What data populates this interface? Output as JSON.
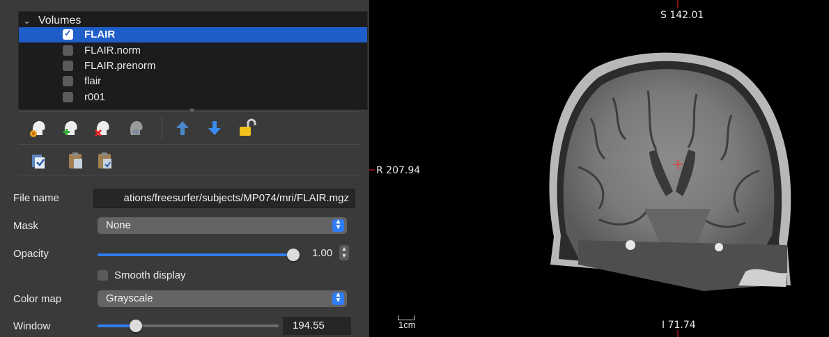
{
  "layer_tree": {
    "header": "Volumes",
    "items": [
      {
        "label": "FLAIR",
        "checked": true,
        "selected": true
      },
      {
        "label": "FLAIR.norm",
        "checked": false,
        "selected": false
      },
      {
        "label": "FLAIR.prenorm",
        "checked": false,
        "selected": false
      },
      {
        "label": "flair",
        "checked": false,
        "selected": false
      },
      {
        "label": "r001",
        "checked": false,
        "selected": false
      }
    ]
  },
  "toolbar": {
    "icons": [
      "load-volume-icon",
      "new-volume-icon",
      "close-volume-icon",
      "save-volume-icon",
      "move-up-icon",
      "move-down-icon",
      "lock-icon"
    ],
    "row2_icons": [
      "copy-settings-icon",
      "paste-settings-icon",
      "paste-all-icon"
    ]
  },
  "properties": {
    "file_name_label": "File name",
    "file_name_value": "ations/freesurfer/subjects/MP074/mri/FLAIR.mgz",
    "mask_label": "Mask",
    "mask_value": "None",
    "opacity_label": "Opacity",
    "opacity_value": "1.00",
    "opacity_fraction": 1.0,
    "smooth_label": "Smooth display",
    "smooth_checked": false,
    "colormap_label": "Color map",
    "colormap_value": "Grayscale",
    "window_label": "Window",
    "window_value": "194.55",
    "window_fraction": 0.19
  },
  "viewer": {
    "superior_label": "S 142.01",
    "right_label": "R 207.94",
    "inferior_label": "I 71.74",
    "scale_label": "1cm",
    "cursor_color": "#ff2020"
  },
  "colors": {
    "selection": "#1f5ec9",
    "accent": "#2f7df6",
    "panel": "#3a3a3a"
  }
}
